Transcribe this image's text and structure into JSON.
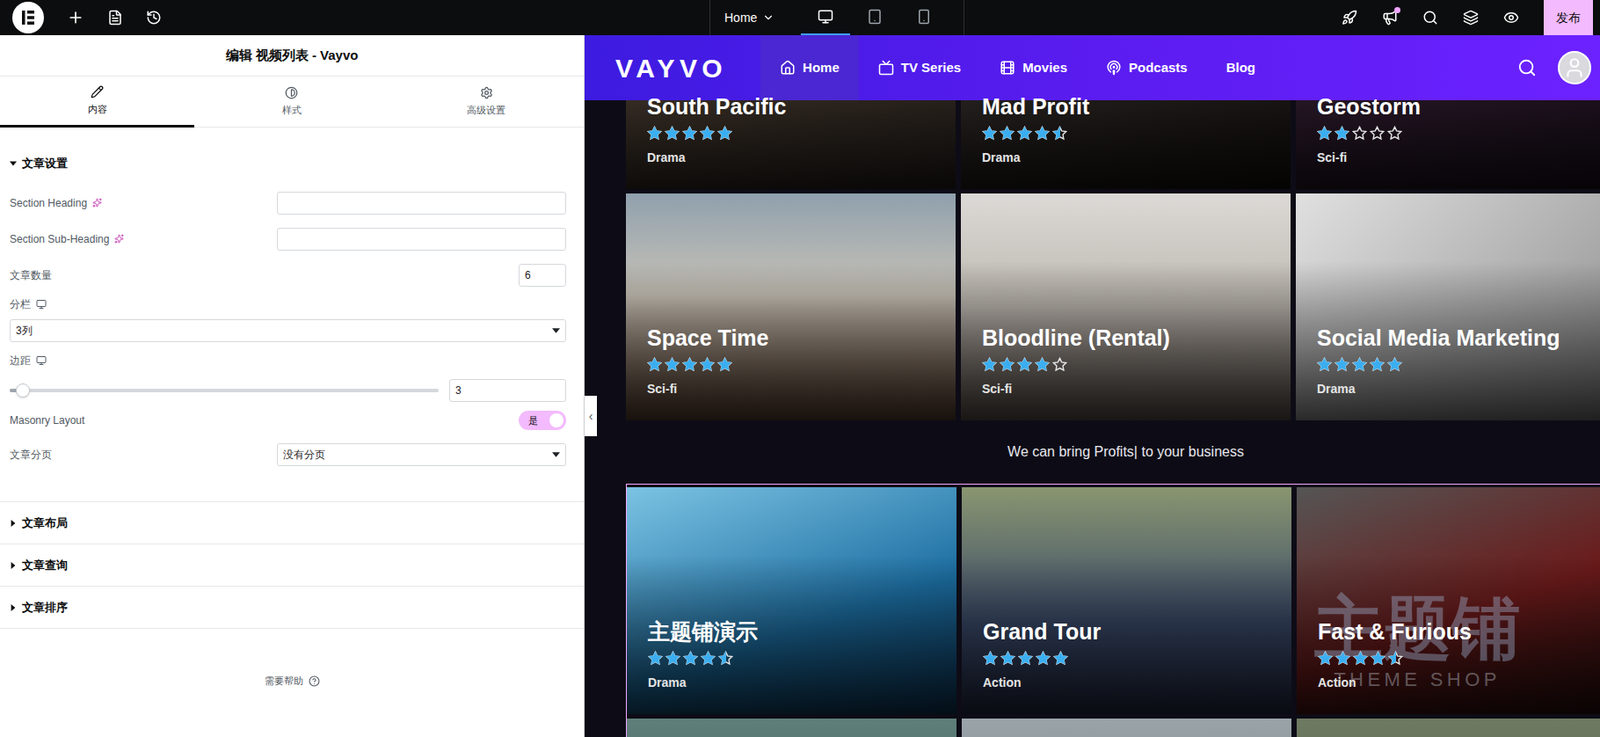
{
  "topbar": {
    "page": "Home",
    "devices": [
      {
        "kind": "desktop",
        "selected": true
      },
      {
        "kind": "tablet",
        "selected": false
      },
      {
        "kind": "mobile",
        "selected": false
      }
    ],
    "notification_dot": true,
    "publish": "发布"
  },
  "panel": {
    "title": "编辑 视频列表 - Vayvo",
    "tabs": [
      {
        "label": "内容",
        "selected": true
      },
      {
        "label": "样式",
        "selected": false
      },
      {
        "label": "高级设置",
        "selected": false
      }
    ],
    "open_section": {
      "label": "文章设置",
      "expanded": true
    },
    "fields": [
      {
        "kind": "text",
        "label": "Section Heading",
        "ai": true,
        "value": ""
      },
      {
        "kind": "text",
        "label": "Section Sub-Heading",
        "ai": true,
        "value": ""
      },
      {
        "kind": "number",
        "label": "文章数量",
        "value": "6"
      },
      {
        "kind": "select",
        "label": "分栏",
        "responsive": true,
        "value": "3列"
      },
      {
        "kind": "slider",
        "label": "边距",
        "responsive": true,
        "value": "3",
        "level": 0.03
      },
      {
        "kind": "switch",
        "label": "Masonry Layout",
        "on": true,
        "value": "是"
      },
      {
        "kind": "inline-select",
        "label": "文章分页",
        "value": "没有分页"
      }
    ],
    "sections": [
      {
        "label": "文章布局",
        "expanded": false
      },
      {
        "label": "文章查询",
        "expanded": false
      },
      {
        "label": "文章排序",
        "expanded": false
      }
    ],
    "help": "需要帮助",
    "collapse_handle": "‹"
  },
  "site": {
    "logo": "VAYVO",
    "nav": [
      {
        "label": "Home",
        "selected": true
      },
      {
        "label": "TV Series",
        "selected": false
      },
      {
        "label": "Movies",
        "selected": false
      },
      {
        "label": "Podcasts",
        "selected": false
      },
      {
        "label": "Blog",
        "selected": false
      }
    ],
    "grid_top": {
      "selected": false,
      "rows": [
        [
          {
            "title": "South Pacific",
            "stars": 5,
            "genre": "Drama"
          },
          {
            "title": "Mad Profit",
            "stars": 4.5,
            "genre": "Drama"
          },
          {
            "title": "Geostorm",
            "stars": 2,
            "genre": "Sci-fi"
          }
        ],
        [
          {
            "title": "Space Time",
            "stars": 5,
            "genre": "Sci-fi"
          },
          {
            "title": "Bloodline (Rental)",
            "stars": 4,
            "genre": "Sci-fi"
          },
          {
            "title": "Social Media Marketing",
            "stars": 5,
            "genre": "Drama"
          }
        ]
      ]
    },
    "tagline": "We can bring Profits| to your business",
    "grid_bottom": {
      "selected": true,
      "rows": [
        [
          {
            "title": "主题铺演示",
            "stars": 4.5,
            "genre": "Drama"
          },
          {
            "title": "Grand Tour",
            "stars": 5,
            "genre": "Action"
          },
          {
            "title": "Fast & Furious",
            "stars": 4.5,
            "genre": "Action"
          }
        ]
      ]
    },
    "watermark": {
      "title": "主题铺",
      "subtitle": "THEME SHOP"
    }
  }
}
